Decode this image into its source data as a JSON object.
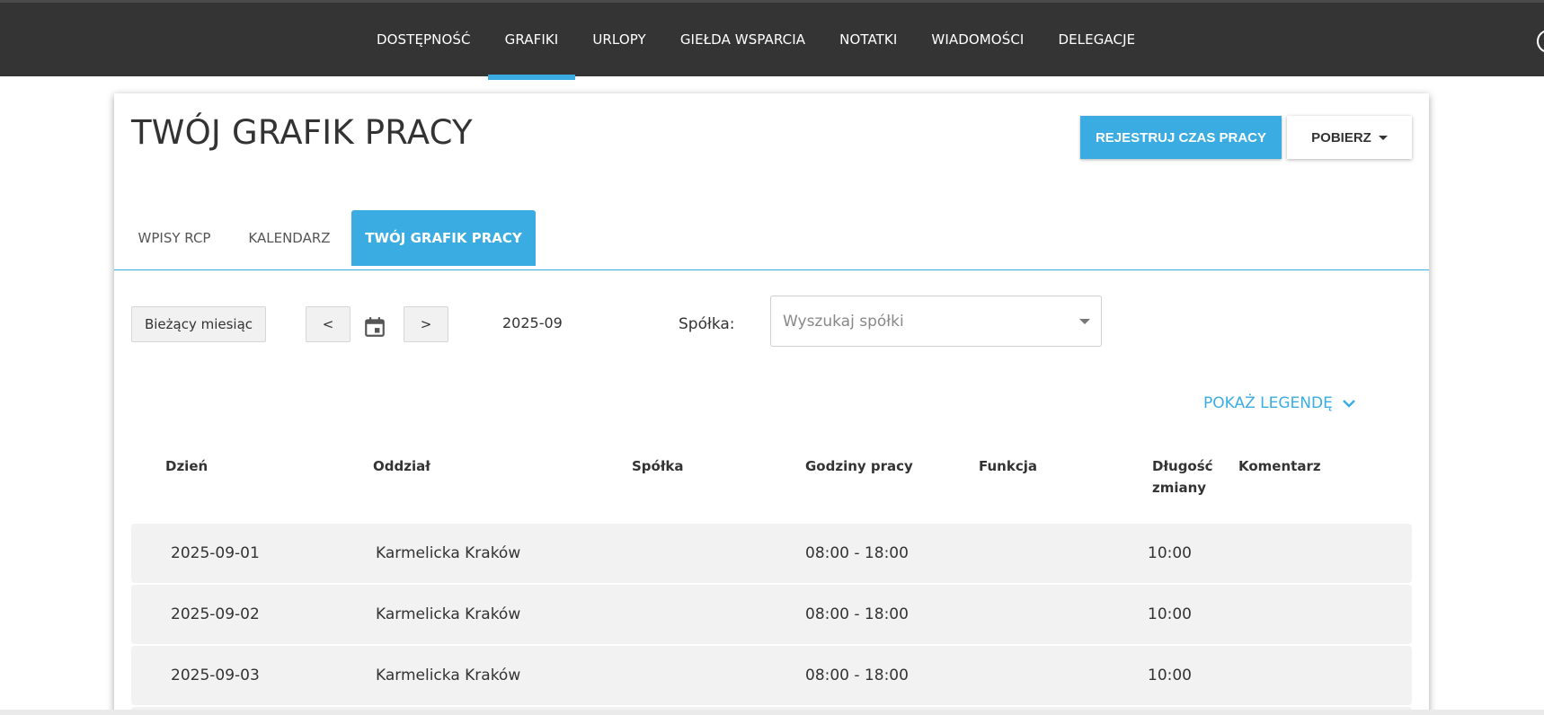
{
  "nav": {
    "items": [
      {
        "label": "DOSTĘPNOŚĆ",
        "active": false
      },
      {
        "label": "GRAFIKI",
        "active": true
      },
      {
        "label": "URLOPY",
        "active": false
      },
      {
        "label": "GIEŁDA WSPARCIA",
        "active": false
      },
      {
        "label": "NOTATKI",
        "active": false
      },
      {
        "label": "WIADOMOŚCI",
        "active": false
      },
      {
        "label": "DELEGACJE",
        "active": false
      }
    ]
  },
  "header": {
    "title": "TWÓJ GRAFIK PRACY",
    "register_button": "REJESTRUJ CZAS PRACY",
    "download_button": "POBIERZ"
  },
  "tabs": [
    {
      "label": "WPISY RCP",
      "active": false
    },
    {
      "label": "KALENDARZ",
      "active": false
    },
    {
      "label": "TWÓJ GRAFIK PRACY",
      "active": true
    }
  ],
  "toolbar": {
    "current_month_button": "Bieżący miesiąc",
    "prev_button": "<",
    "next_button": ">",
    "month": "2025-09",
    "company_label": "Spółka:",
    "company_placeholder": "Wyszukaj spółki"
  },
  "legend": {
    "toggle_label": "POKAŻ LEGENDĘ"
  },
  "table": {
    "headers": {
      "day": "Dzień",
      "branch": "Oddział",
      "company": "Spółka",
      "hours": "Godziny pracy",
      "function": "Funkcja",
      "length_line1": "Długość",
      "length_line2": "zmiany",
      "comment": "Komentarz"
    },
    "rows": [
      {
        "day": "2025-09-01",
        "branch": "Karmelicka Kraków",
        "company": "",
        "hours": "08:00 - 18:00",
        "function": "",
        "length": "10:00",
        "comment": ""
      },
      {
        "day": "2025-09-02",
        "branch": "Karmelicka Kraków",
        "company": "",
        "hours": "08:00 - 18:00",
        "function": "",
        "length": "10:00",
        "comment": ""
      },
      {
        "day": "2025-09-03",
        "branch": "Karmelicka Kraków",
        "company": "",
        "hours": "08:00 - 18:00",
        "function": "",
        "length": "10:00",
        "comment": ""
      }
    ]
  },
  "colors": {
    "accent": "#3bace2",
    "topbar": "#343434",
    "row_background": "#f2f2f2"
  }
}
